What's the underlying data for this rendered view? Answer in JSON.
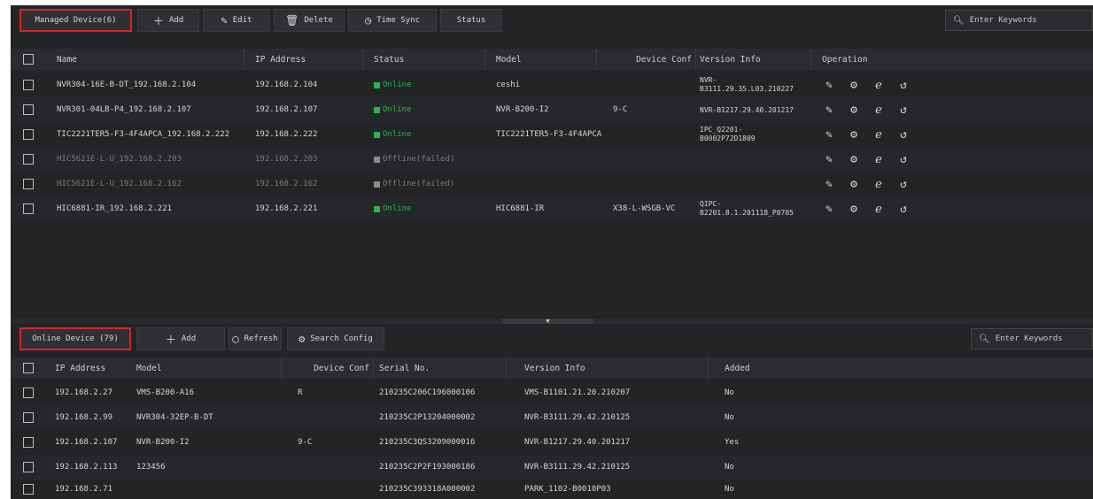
{
  "managed": {
    "toolbar": {
      "title": "Managed Device(6)",
      "add": "Add",
      "edit": "Edit",
      "delete": "Delete",
      "time_sync": "Time Sync",
      "status": "Status",
      "search_placeholder": "Enter Keywords"
    },
    "columns": [
      "Name",
      "IP Address",
      "Status",
      "Model",
      "Device Conf",
      "Version Info",
      "Operation"
    ],
    "rows": [
      {
        "name": "NVR304-16E-B-DT_192.168.2.104",
        "ip": "192.168.2.104",
        "status": "Online",
        "model": "ceshi",
        "conf": "",
        "version": [
          "NVR-",
          "B3111.29.35.L03.210227"
        ],
        "online": true
      },
      {
        "name": "NVR301-04LB-P4_192.168.2.107",
        "ip": "192.168.2.107",
        "status": "Online",
        "model": "NVR-B200-I2",
        "conf": "9-C",
        "version": [
          "NVR-B1217.29.40.201217"
        ],
        "online": true
      },
      {
        "name": "TIC2221TER5-F3-4F4APCA_192.168.2.222",
        "ip": "192.168.2.222",
        "status": "Online",
        "model": "TIC2221TER5-F3-4F4APCA",
        "conf": "",
        "version": [
          "IPC_Q2201-",
          "B0002P72D1809"
        ],
        "online": true
      },
      {
        "name": "HIC5621E-L-U_192.168.2.203",
        "ip": "192.168.2.203",
        "status": "Offline(failed)",
        "model": "",
        "conf": "",
        "version": [],
        "online": false
      },
      {
        "name": "HIC5621E-L-U_192.168.2.162",
        "ip": "192.168.2.162",
        "status": "Offline(failed)",
        "model": "",
        "conf": "",
        "version": [],
        "online": false
      },
      {
        "name": "HIC6881-IR_192.168.2.221",
        "ip": "192.168.2.221",
        "status": "Online",
        "model": "HIC6881-IR",
        "conf": "X38-L-WSGB-VC",
        "version": [
          "QIPC-",
          "B2201.8.1.201118_P0705"
        ],
        "online": true
      }
    ]
  },
  "online": {
    "toolbar": {
      "title": "Online Device (79)",
      "add": "Add",
      "refresh": "Refresh",
      "search_config": "Search Config",
      "search_placeholder": "Enter Keywords"
    },
    "columns": [
      "IP Address",
      "Model",
      "Device Conf",
      "Serial No.",
      "Version Info",
      "Added"
    ],
    "rows": [
      {
        "ip": "192.168.2.27",
        "model": "VMS-B200-A16",
        "conf": "R",
        "serial": "210235C206C196000106",
        "version": "VMS-B1101.21.20.210207",
        "added": "No"
      },
      {
        "ip": "192.168.2.99",
        "model": "NVR304-32EP-B-DT",
        "conf": "",
        "serial": "210235C2P13204000002",
        "version": "NVR-B3111.29.42.210125",
        "added": "No"
      },
      {
        "ip": "192.168.2.107",
        "model": "NVR-B200-I2",
        "conf": "9-C",
        "serial": "210235C3QS3209000016",
        "version": "NVR-B1217.29.40.201217",
        "added": "Yes"
      },
      {
        "ip": "192.168.2.113",
        "model": "123456",
        "conf": "",
        "serial": "210235C2P2F193000186",
        "version": "NVR-B3111.29.42.210125",
        "added": "No"
      },
      {
        "ip": "192.168.2.71",
        "model": "",
        "conf": "",
        "serial": "210235C393318A000002",
        "version": "PARK_1102-B0010P03",
        "added": "No"
      }
    ]
  },
  "icons": {
    "add": "plus-icon",
    "edit": "pencil-icon",
    "delete": "trash-icon",
    "time_sync": "clock-icon",
    "search": "magnifier-icon",
    "refresh": "refresh-icon",
    "config": "gear-icon"
  },
  "colors": {
    "online": "#2fb24a",
    "offline": "#8a8a8a",
    "highlight": "#d22626"
  }
}
